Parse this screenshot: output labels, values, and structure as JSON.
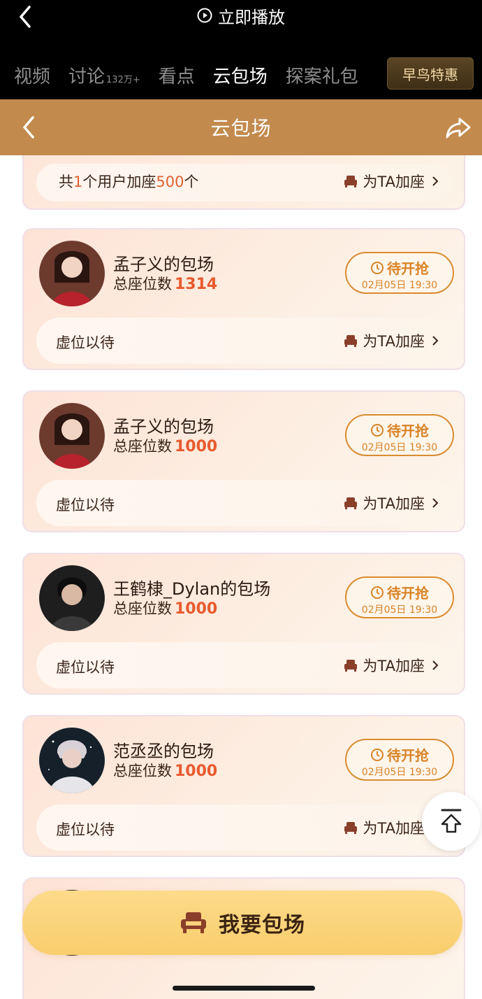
{
  "top": {
    "play_label": "立即播放",
    "tabs": [
      {
        "label": "视频",
        "sub": ""
      },
      {
        "label": "讨论",
        "sub": "132万+"
      },
      {
        "label": "看点",
        "sub": ""
      },
      {
        "label": "云包场",
        "sub": ""
      },
      {
        "label": "探案礼包",
        "sub": ""
      }
    ],
    "active_tab": "云包场",
    "early_bird": "早鸟特惠"
  },
  "header": {
    "title": "云包场"
  },
  "partial_card": {
    "text_pre": "共",
    "users": "1",
    "text_mid": "个用户加座",
    "seats": "500",
    "text_post": "个",
    "add_seat_label": "为TA加座"
  },
  "cards": [
    {
      "name": "孟子义的包场",
      "seats_label": "总座位数",
      "seats": "1314",
      "badge": "待开抢",
      "time": "02月05日 19:30",
      "status": "虚位以待",
      "add_seat_label": "为TA加座"
    },
    {
      "name": "孟子义的包场",
      "seats_label": "总座位数",
      "seats": "1000",
      "badge": "待开抢",
      "time": "02月05日 19:30",
      "status": "虚位以待",
      "add_seat_label": "为TA加座"
    },
    {
      "name": "王鹤棣_Dylan的包场",
      "seats_label": "总座位数",
      "seats": "1000",
      "badge": "待开抢",
      "time": "02月05日 19:30",
      "status": "虚位以待",
      "add_seat_label": "为TA加座"
    },
    {
      "name": "范丞丞的包场",
      "seats_label": "总座位数",
      "seats": "1000",
      "badge": "待开抢",
      "time": "02月05日 19:30",
      "status": "虚位以待",
      "add_seat_label": "为TA加座"
    }
  ],
  "cta": {
    "label": "我要包场"
  },
  "colors": {
    "header_bg": "#c38a4e",
    "accent_orange": "#e85a2e",
    "badge_gold": "#d98326",
    "cta_yellow": "#fcdb8a"
  }
}
